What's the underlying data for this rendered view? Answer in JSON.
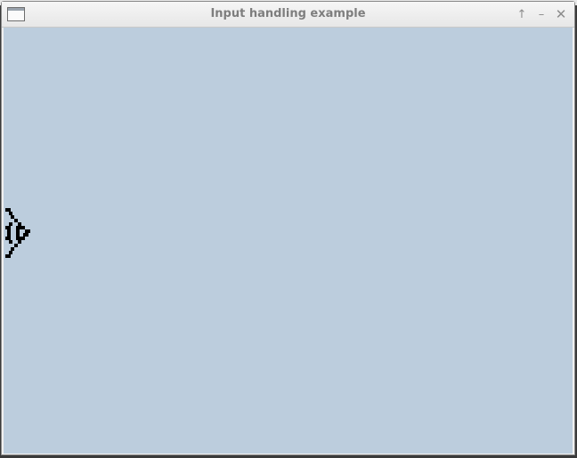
{
  "window": {
    "title": "Input handling example",
    "app_icon": "window-icon",
    "controls": {
      "maximize_glyph": "↑",
      "minimize_glyph": "–",
      "close_glyph": "✕"
    }
  },
  "canvas": {
    "background_color": "#bccddd",
    "sprite": {
      "icon": "arrow-sprite-icon",
      "color": "#000000"
    }
  }
}
